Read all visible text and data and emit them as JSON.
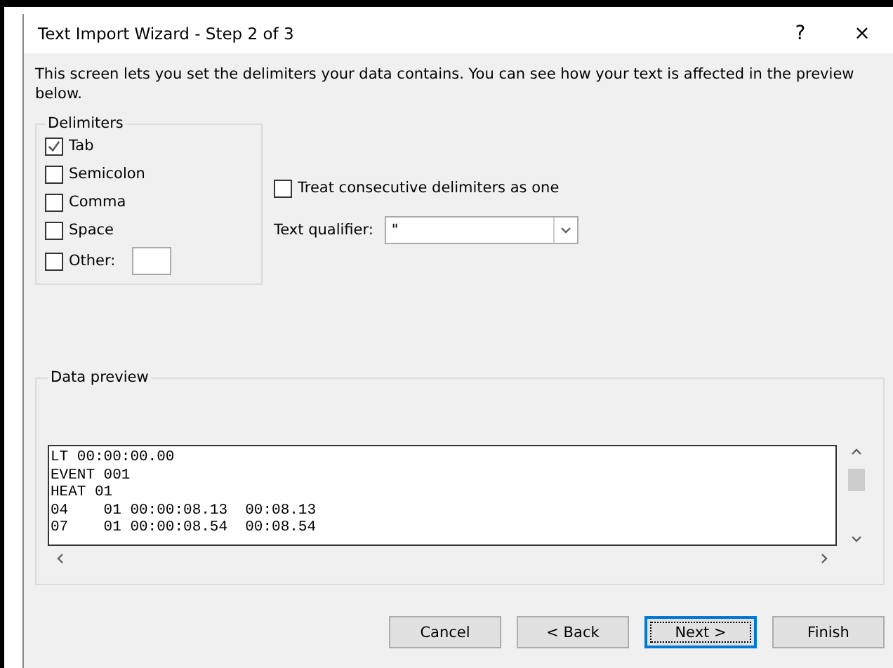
{
  "window": {
    "title": "Text Import Wizard - Step 2 of 3",
    "help": "?",
    "close": "×"
  },
  "description": "This screen lets you set the delimiters your data contains.  You can see how your text is affected in the preview below.",
  "delimiters": {
    "title": "Delimiters",
    "items": [
      {
        "label": "Tab",
        "checked": true
      },
      {
        "label": "Semicolon",
        "checked": false
      },
      {
        "label": "Comma",
        "checked": false
      },
      {
        "label": "Space",
        "checked": false
      },
      {
        "label": "Other:",
        "checked": false,
        "kind": "other"
      }
    ]
  },
  "consecutive": {
    "label": "Treat consecutive delimiters as one",
    "checked": false
  },
  "qualifier": {
    "label": "Text qualifier:",
    "value": "\""
  },
  "preview": {
    "title": "Data preview",
    "lines": [
      "LT 00:00:00.00",
      "EVENT 001",
      "HEAT 01",
      "04    01 00:00:08.13  00:08.13",
      "07    01 00:00:08.54  00:08.54"
    ]
  },
  "buttons": [
    {
      "label": "Cancel",
      "selected": false
    },
    {
      "label": "< Back",
      "selected": false
    },
    {
      "label": "Next >",
      "selected": true
    },
    {
      "label": "Finish",
      "selected": false
    }
  ]
}
